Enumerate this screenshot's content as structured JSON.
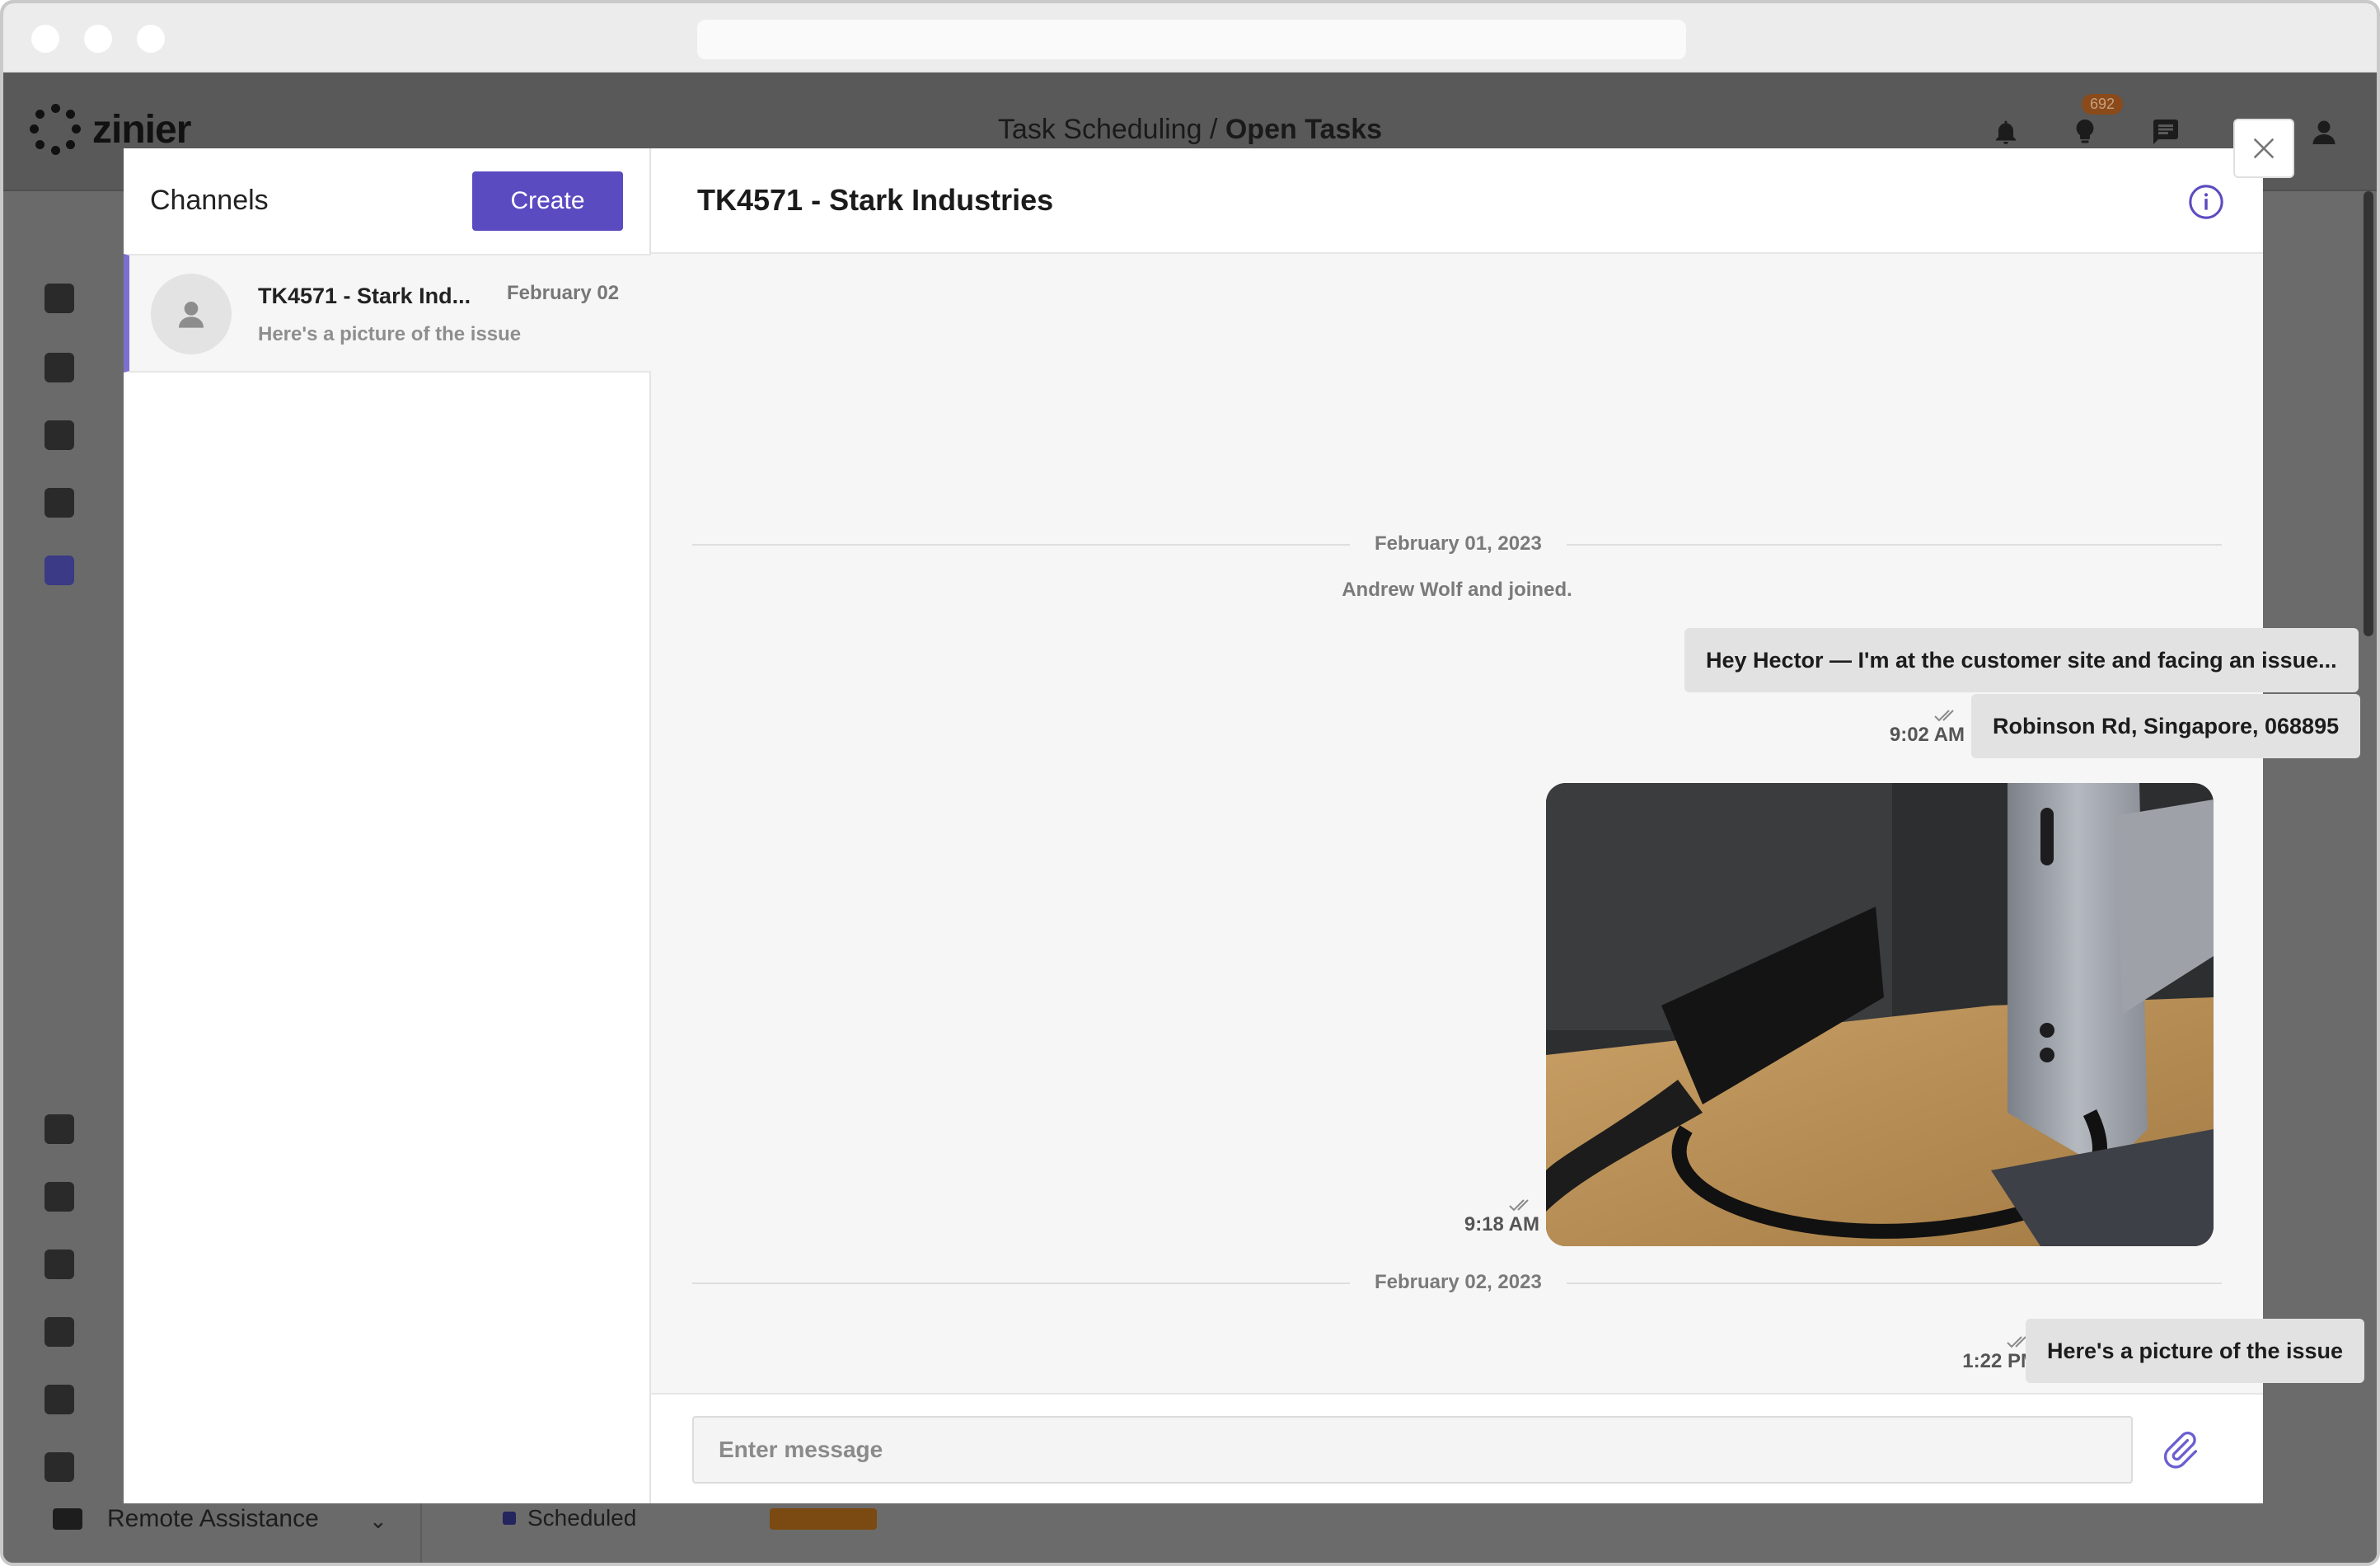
{
  "app": {
    "logo_text": "zinier",
    "title_prefix": "Task Scheduling /",
    "title_current": "Open Tasks",
    "notifications_badge": "692",
    "sidebar_bottom_item": "Remote Assistance",
    "bg_status": "Scheduled"
  },
  "channels": {
    "title": "Channels",
    "create_label": "Create",
    "items": [
      {
        "name": "TK4571 - Stark Ind...",
        "date": "February 02",
        "preview": "Here's a picture of the issue"
      }
    ]
  },
  "chat": {
    "title": "TK4571 - Stark Industries",
    "messages": {
      "date1": "February 01, 2023",
      "system": "Andrew Wolf and joined.",
      "msg1": "Hey Hector — I'm at the customer site and facing an issue...",
      "msg2": "Robinson Rd, Singapore, 068895",
      "time1": "9:02 AM",
      "time_photo": "9:18 AM",
      "date2": "February 02, 2023",
      "msg3": "Here's a picture of the issue",
      "time3": "1:22 PM"
    },
    "composer": {
      "placeholder": "Enter message"
    }
  },
  "colors": {
    "accent": "#5b4bc0",
    "active_border": "#7b6fd0",
    "overlay": "#6b6b6b"
  }
}
